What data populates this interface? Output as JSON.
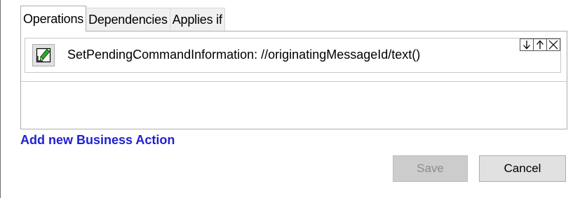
{
  "tabs": [
    {
      "label": "Operations",
      "active": true
    },
    {
      "label": "Dependencies",
      "active": false
    },
    {
      "label": "Applies if",
      "active": false
    }
  ],
  "operations": [
    {
      "icon": "edit-pencil-icon",
      "label": "SetPendingCommandInformation: //originatingMessageId/text()",
      "controls": [
        "move-down-icon",
        "move-up-icon",
        "remove-icon"
      ]
    }
  ],
  "add_action_label": "Add new Business Action",
  "buttons": {
    "save_label": "Save",
    "save_enabled": false,
    "cancel_label": "Cancel"
  },
  "colors": {
    "link": "#1f1fd6",
    "disabled_button_bg": "#cccccc",
    "disabled_button_text": "#8d8d8d"
  }
}
